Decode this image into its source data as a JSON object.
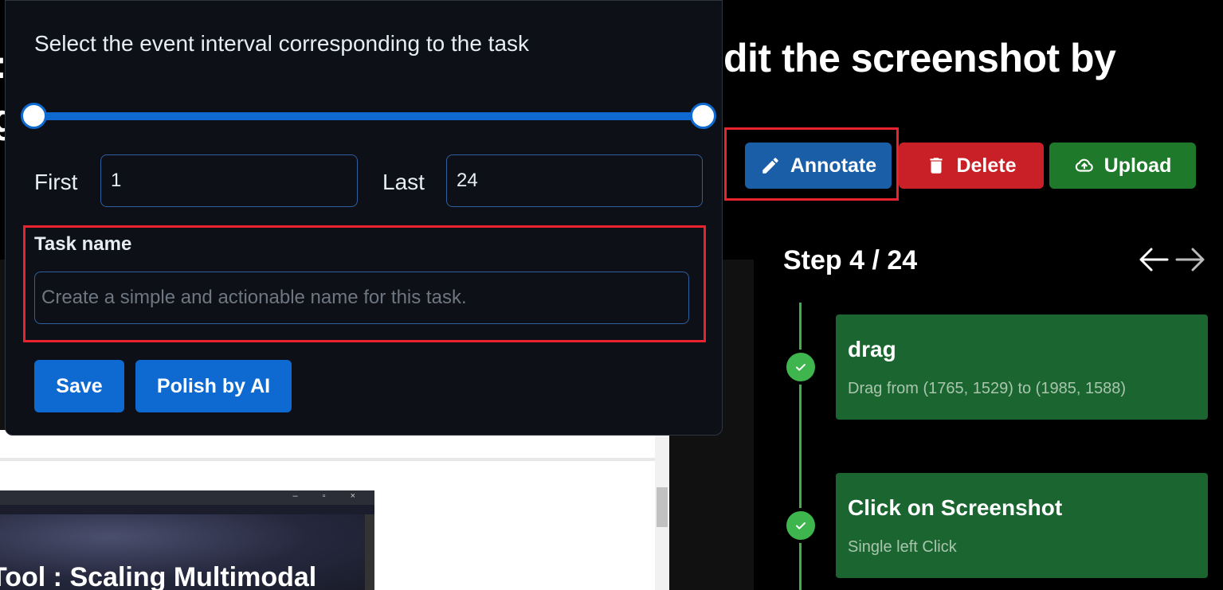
{
  "background": {
    "heading": "dit the screenshot by",
    "left_glyph_top": ":",
    "left_glyph_bottom": "g"
  },
  "toolbar": {
    "annotate_label": "Annotate",
    "delete_label": "Delete",
    "upload_label": "Upload"
  },
  "steps": {
    "title": "Step 4 / 24",
    "items": [
      {
        "name": "drag",
        "description": "Drag from (1765, 1529) to (1985, 1588)"
      },
      {
        "name": "Click on Screenshot",
        "description": "Single left Click"
      }
    ]
  },
  "preview": {
    "window_text": "Tool : Scaling Multimodal",
    "window_buttons": "– ▫ ×"
  },
  "dialog": {
    "title": "Select the event interval corresponding to the task",
    "first_label": "First",
    "first_value": "1",
    "last_label": "Last",
    "last_value": "24",
    "task_label": "Task name",
    "task_placeholder": "Create a simple and actionable name for this task.",
    "save_label": "Save",
    "polish_label": "Polish by AI"
  },
  "colors": {
    "accent_blue": "#0e6ad0",
    "annotate_blue": "#1b5ea8",
    "delete_red": "#c91f26",
    "upload_green": "#1e7a2a",
    "step_card_green": "#1a6530",
    "highlight_red": "#e8232f"
  }
}
